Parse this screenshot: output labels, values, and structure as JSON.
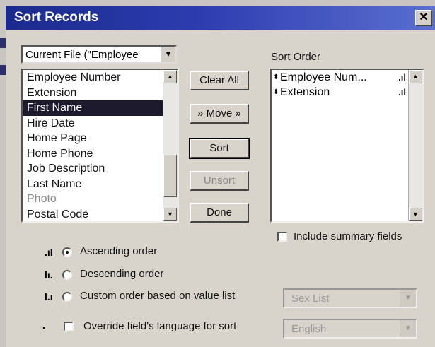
{
  "window": {
    "title": "Sort Records"
  },
  "file_combo": {
    "value": "Current File (\"Employee"
  },
  "field_list": {
    "items": [
      {
        "label": "Employee Number",
        "state": "normal"
      },
      {
        "label": "Extension",
        "state": "normal"
      },
      {
        "label": "First Name",
        "state": "selected"
      },
      {
        "label": "Hire Date",
        "state": "normal"
      },
      {
        "label": "Home Page",
        "state": "normal"
      },
      {
        "label": "Home Phone",
        "state": "normal"
      },
      {
        "label": "Job Description",
        "state": "normal"
      },
      {
        "label": "Last Name",
        "state": "normal"
      },
      {
        "label": "Photo",
        "state": "disabled"
      },
      {
        "label": "Postal Code",
        "state": "normal"
      }
    ]
  },
  "buttons": {
    "clear_all": "Clear All",
    "move": "» Move »",
    "sort": "Sort",
    "unsort": "Unsort",
    "done": "Done"
  },
  "sort_order": {
    "label": "Sort Order",
    "items": [
      {
        "label": "Employee Num...",
        "order": "ascending"
      },
      {
        "label": "Extension",
        "order": "ascending"
      }
    ]
  },
  "include_summary": {
    "label": "Include summary fields",
    "checked": false
  },
  "order_options": {
    "ascending": "Ascending order",
    "descending": "Descending order",
    "custom": "Custom order based on value list",
    "selected": "ascending"
  },
  "value_list_select": {
    "value": "Sex List"
  },
  "override_language": {
    "label": "Override field's language for sort",
    "checked": false
  },
  "language_select": {
    "value": "English"
  },
  "colors": {
    "titlebar": "#1a2a8c",
    "selection": "#1e1a2e",
    "dialog": "#d8d4cc"
  }
}
